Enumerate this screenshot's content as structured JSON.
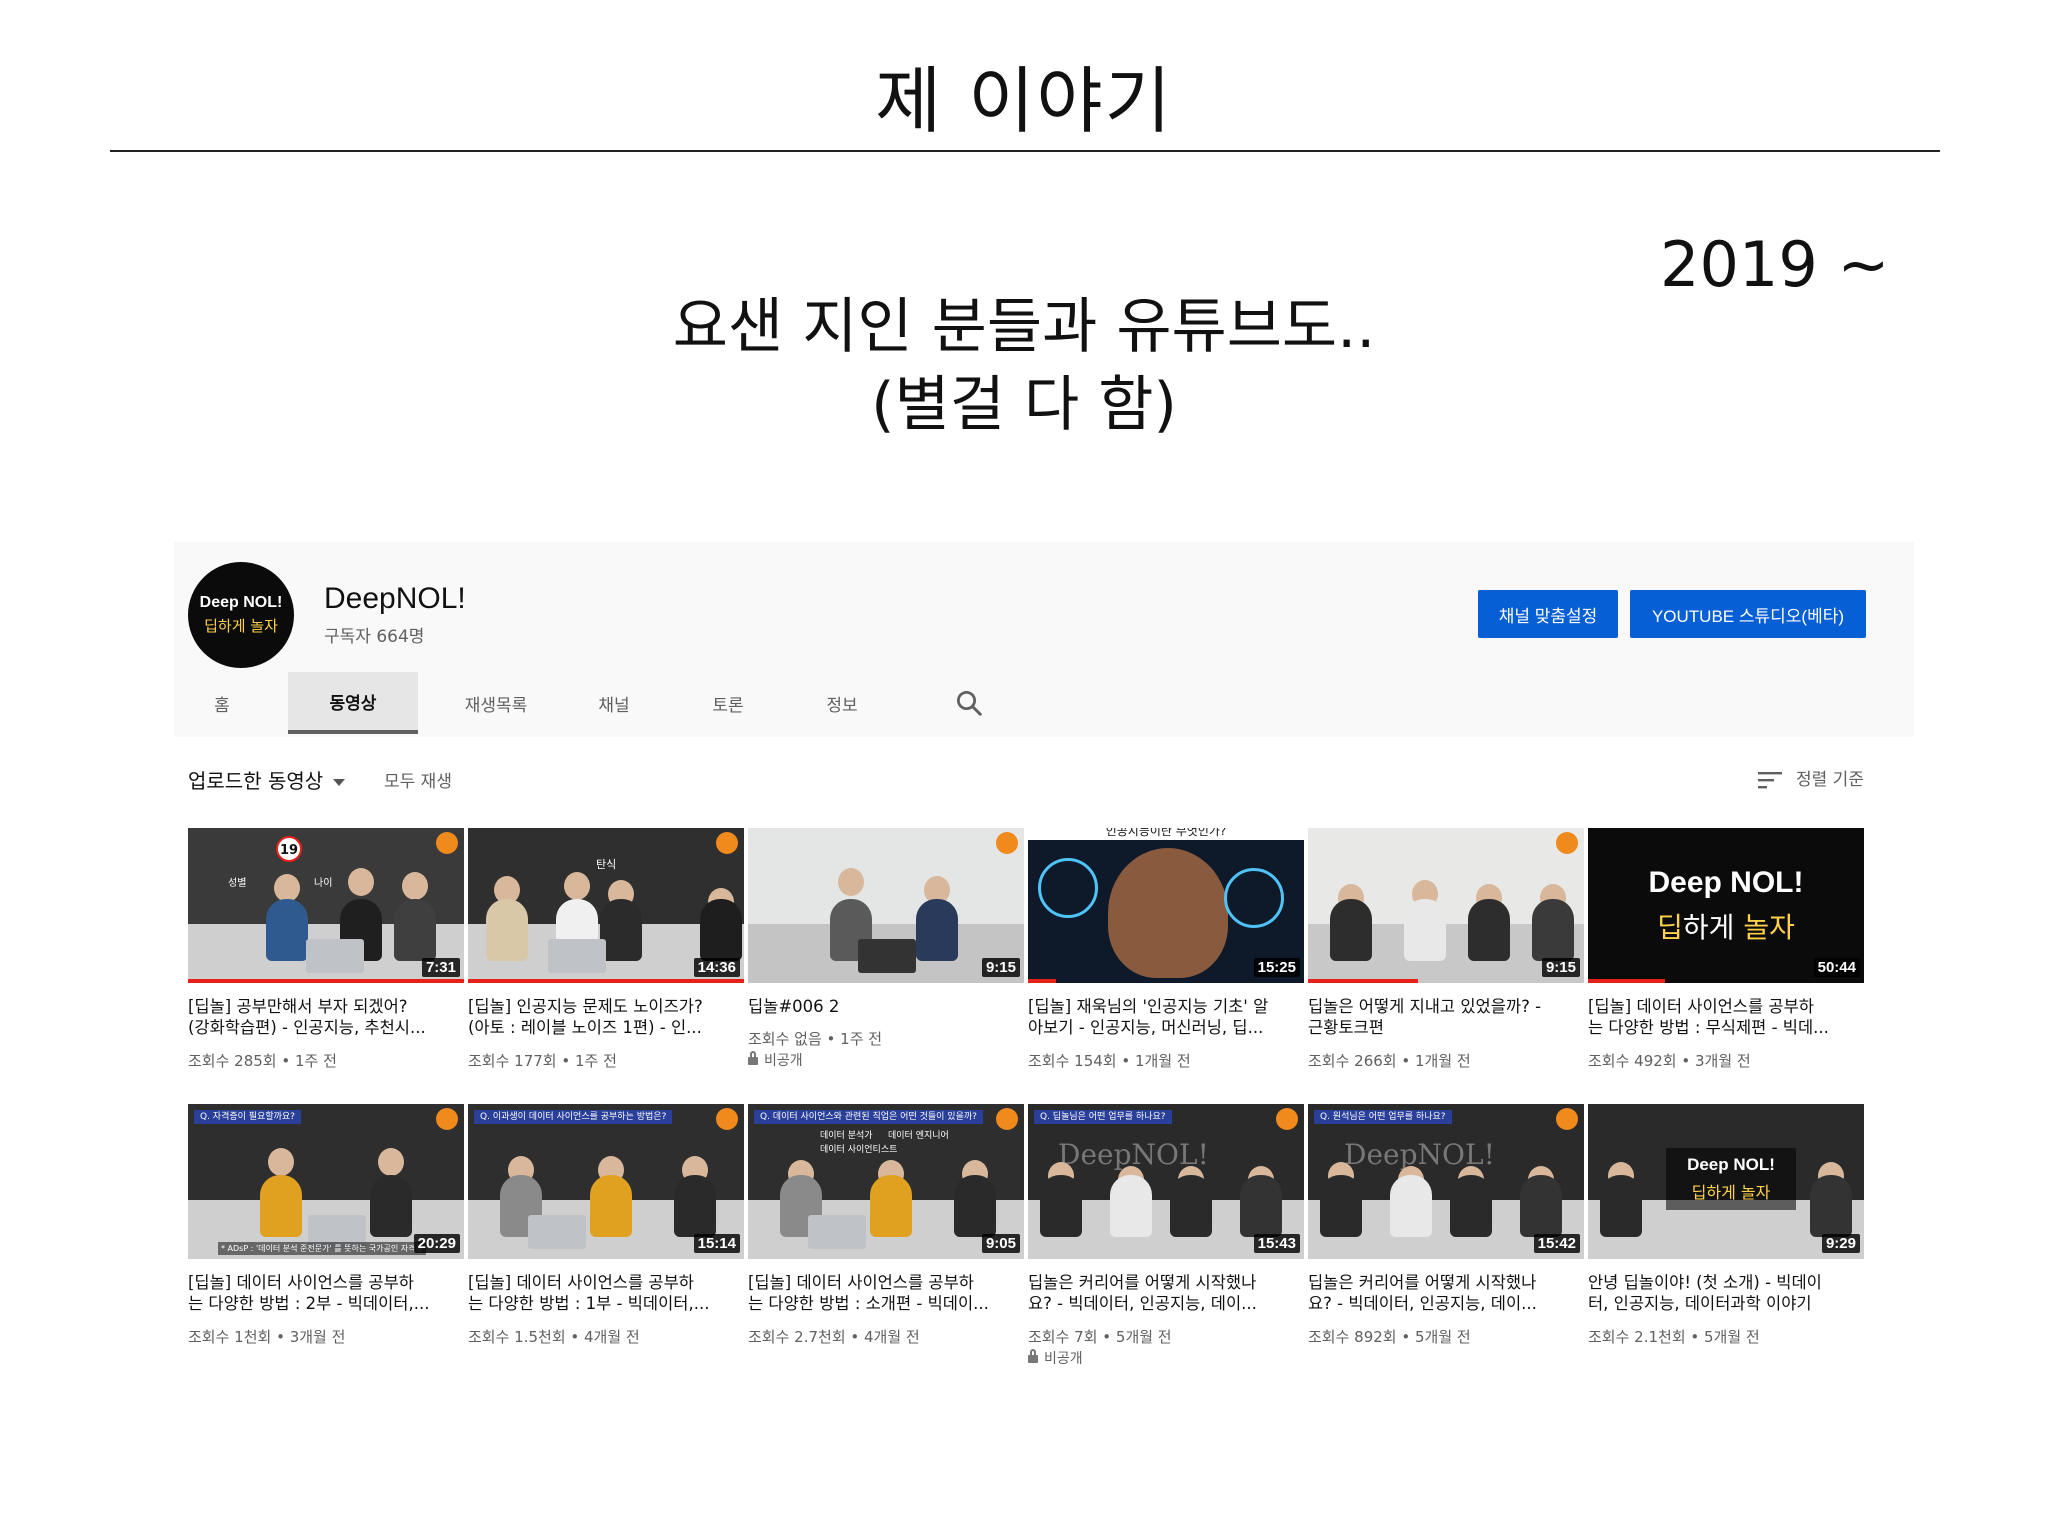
{
  "slide": {
    "title": "제 이야기",
    "year": "2019 ~",
    "subtitle_line1": "요샌 지인 분들과 유튜브도..",
    "subtitle_line2": "(별걸 다 함)"
  },
  "channel": {
    "avatar_line1": "Deep NOL!",
    "avatar_line2": "딥하게 놀자",
    "name": "DeepNOL!",
    "subscribers": "구독자 664명",
    "customize_button": "채널 맞춤설정",
    "studio_button": "YOUTUBE 스튜디오(베타)"
  },
  "tabs": [
    {
      "label": "홈",
      "active": false
    },
    {
      "label": "동영상",
      "active": true
    },
    {
      "label": "재생목록",
      "active": false
    },
    {
      "label": "채널",
      "active": false
    },
    {
      "label": "토론",
      "active": false
    },
    {
      "label": "정보",
      "active": false
    }
  ],
  "filters": {
    "uploads": "업로드한 동영상",
    "play_all": "모두 재생",
    "sort": "정렬 기준"
  },
  "videos": [
    {
      "title1": "[딥놀] 공부만해서 부자 되겠어?",
      "title2": "(강화학습편) - 인공지능, 추천시...",
      "meta": "조회수 285회 • 1주 전",
      "duration": "7:31",
      "progress": 1.0,
      "private": ""
    },
    {
      "title1": "[딥놀] 인공지능 문제도 노이즈가?",
      "title2": "(아토 : 레이블 노이즈 1편) - 인...",
      "meta": "조회수 177회 • 1주 전",
      "duration": "14:36",
      "progress": 1.0,
      "private": ""
    },
    {
      "title1": "딥놀#006 2",
      "title2": "",
      "meta": "조회수 없음 • 1주 전",
      "duration": "9:15",
      "progress": 0,
      "private": "비공개"
    },
    {
      "title1": "[딥놀] 재욱님의 '인공지능 기초' 알",
      "title2": "아보기 - 인공지능, 머신러닝, 딥...",
      "meta": "조회수 154회 • 1개월 전",
      "duration": "15:25",
      "progress": 0.1,
      "private": ""
    },
    {
      "title1": "딥놀은 어떻게 지내고 있었을까? -",
      "title2": "근황토크편",
      "meta": "조회수 266회 • 1개월 전",
      "duration": "9:15",
      "progress": 0.4,
      "private": ""
    },
    {
      "title1": "[딥놀] 데이터 사이언스를 공부하",
      "title2": "는 다양한 방법 : 무식제편 - 빅데...",
      "meta": "조회수 492회 • 3개월 전",
      "duration": "50:44",
      "progress": 0.28,
      "private": ""
    },
    {
      "title1": "[딥놀] 데이터 사이언스를 공부하",
      "title2": "는 다양한 방법 : 2부 - 빅데이터,...",
      "meta": "조회수 1천회 • 3개월 전",
      "duration": "20:29",
      "progress": 0,
      "private": ""
    },
    {
      "title1": "[딥놀] 데이터 사이언스를 공부하",
      "title2": "는 다양한 방법 : 1부 - 빅데이터,...",
      "meta": "조회수 1.5천회 • 4개월 전",
      "duration": "15:14",
      "progress": 0,
      "private": ""
    },
    {
      "title1": "[딥놀] 데이터 사이언스를 공부하",
      "title2": "는 다양한 방법 : 소개편 - 빅데이...",
      "meta": "조회수 2.7천회 • 4개월 전",
      "duration": "9:05",
      "progress": 0,
      "private": ""
    },
    {
      "title1": "딥놀은 커리어를 어떻게 시작했나",
      "title2": "요? - 빅데이터, 인공지능, 데이...",
      "meta": "조회수 7회 • 5개월 전",
      "duration": "15:43",
      "progress": 0,
      "private": "비공개"
    },
    {
      "title1": "딥놀은 커리어를 어떻게 시작했나",
      "title2": "요? - 빅데이터, 인공지능, 데이...",
      "meta": "조회수 892회 • 5개월 전",
      "duration": "15:42",
      "progress": 0,
      "private": ""
    },
    {
      "title1": "안녕 딥놀이야! (첫 소개) - 빅데이",
      "title2": "터, 인공지능, 데이터과학 이야기",
      "meta": "조회수 2.1천회 • 5개월 전",
      "duration": "9:29",
      "progress": 0,
      "private": ""
    }
  ],
  "thumb_overlays": {
    "t1_badge": "19",
    "t1_left": "성별",
    "t1_right": "나이",
    "t2_label": "탄식",
    "t4_caption": "인공지능이란 무엇인가?",
    "t6_line1": "Deep NOL!",
    "t6_line2_a": "딥",
    "t6_line2_b": "하게 ",
    "t6_line2_c": "놀자",
    "t7_banner": "Q. 자격증이 필요할까요?",
    "t7_caption": "* ADsP : '데이터 분석 준전문가' 를 뜻하는 국가공인 자격증",
    "t8_banner": "Q. 이과생이 데이터 사이언스를 공부하는 방법은?",
    "t9_banner": "Q. 데이터 사이언스와 관련된 직업은 어떤 것들이 있을까?",
    "t9_line1": "데이터 분석가",
    "t9_line2": "데이터 엔지니어",
    "t9_line3": "데이터 사이언티스트",
    "t10_banner": "Q. 딥놀님은 어떤 업무를 하나요?",
    "t11_banner": "Q. 원석님은 어떤 업무를 하나요?",
    "t10_board": "DeepNOL!",
    "t11_board": "DeepNOL!",
    "t12_line1": "Deep NOL!",
    "t12_line2": "딥하게 놀자"
  },
  "colors": {
    "primary_button": "#065fd4",
    "progress": "#e62117",
    "header_bg": "#f9f9f9",
    "accent_logo": "#f08a1c"
  }
}
